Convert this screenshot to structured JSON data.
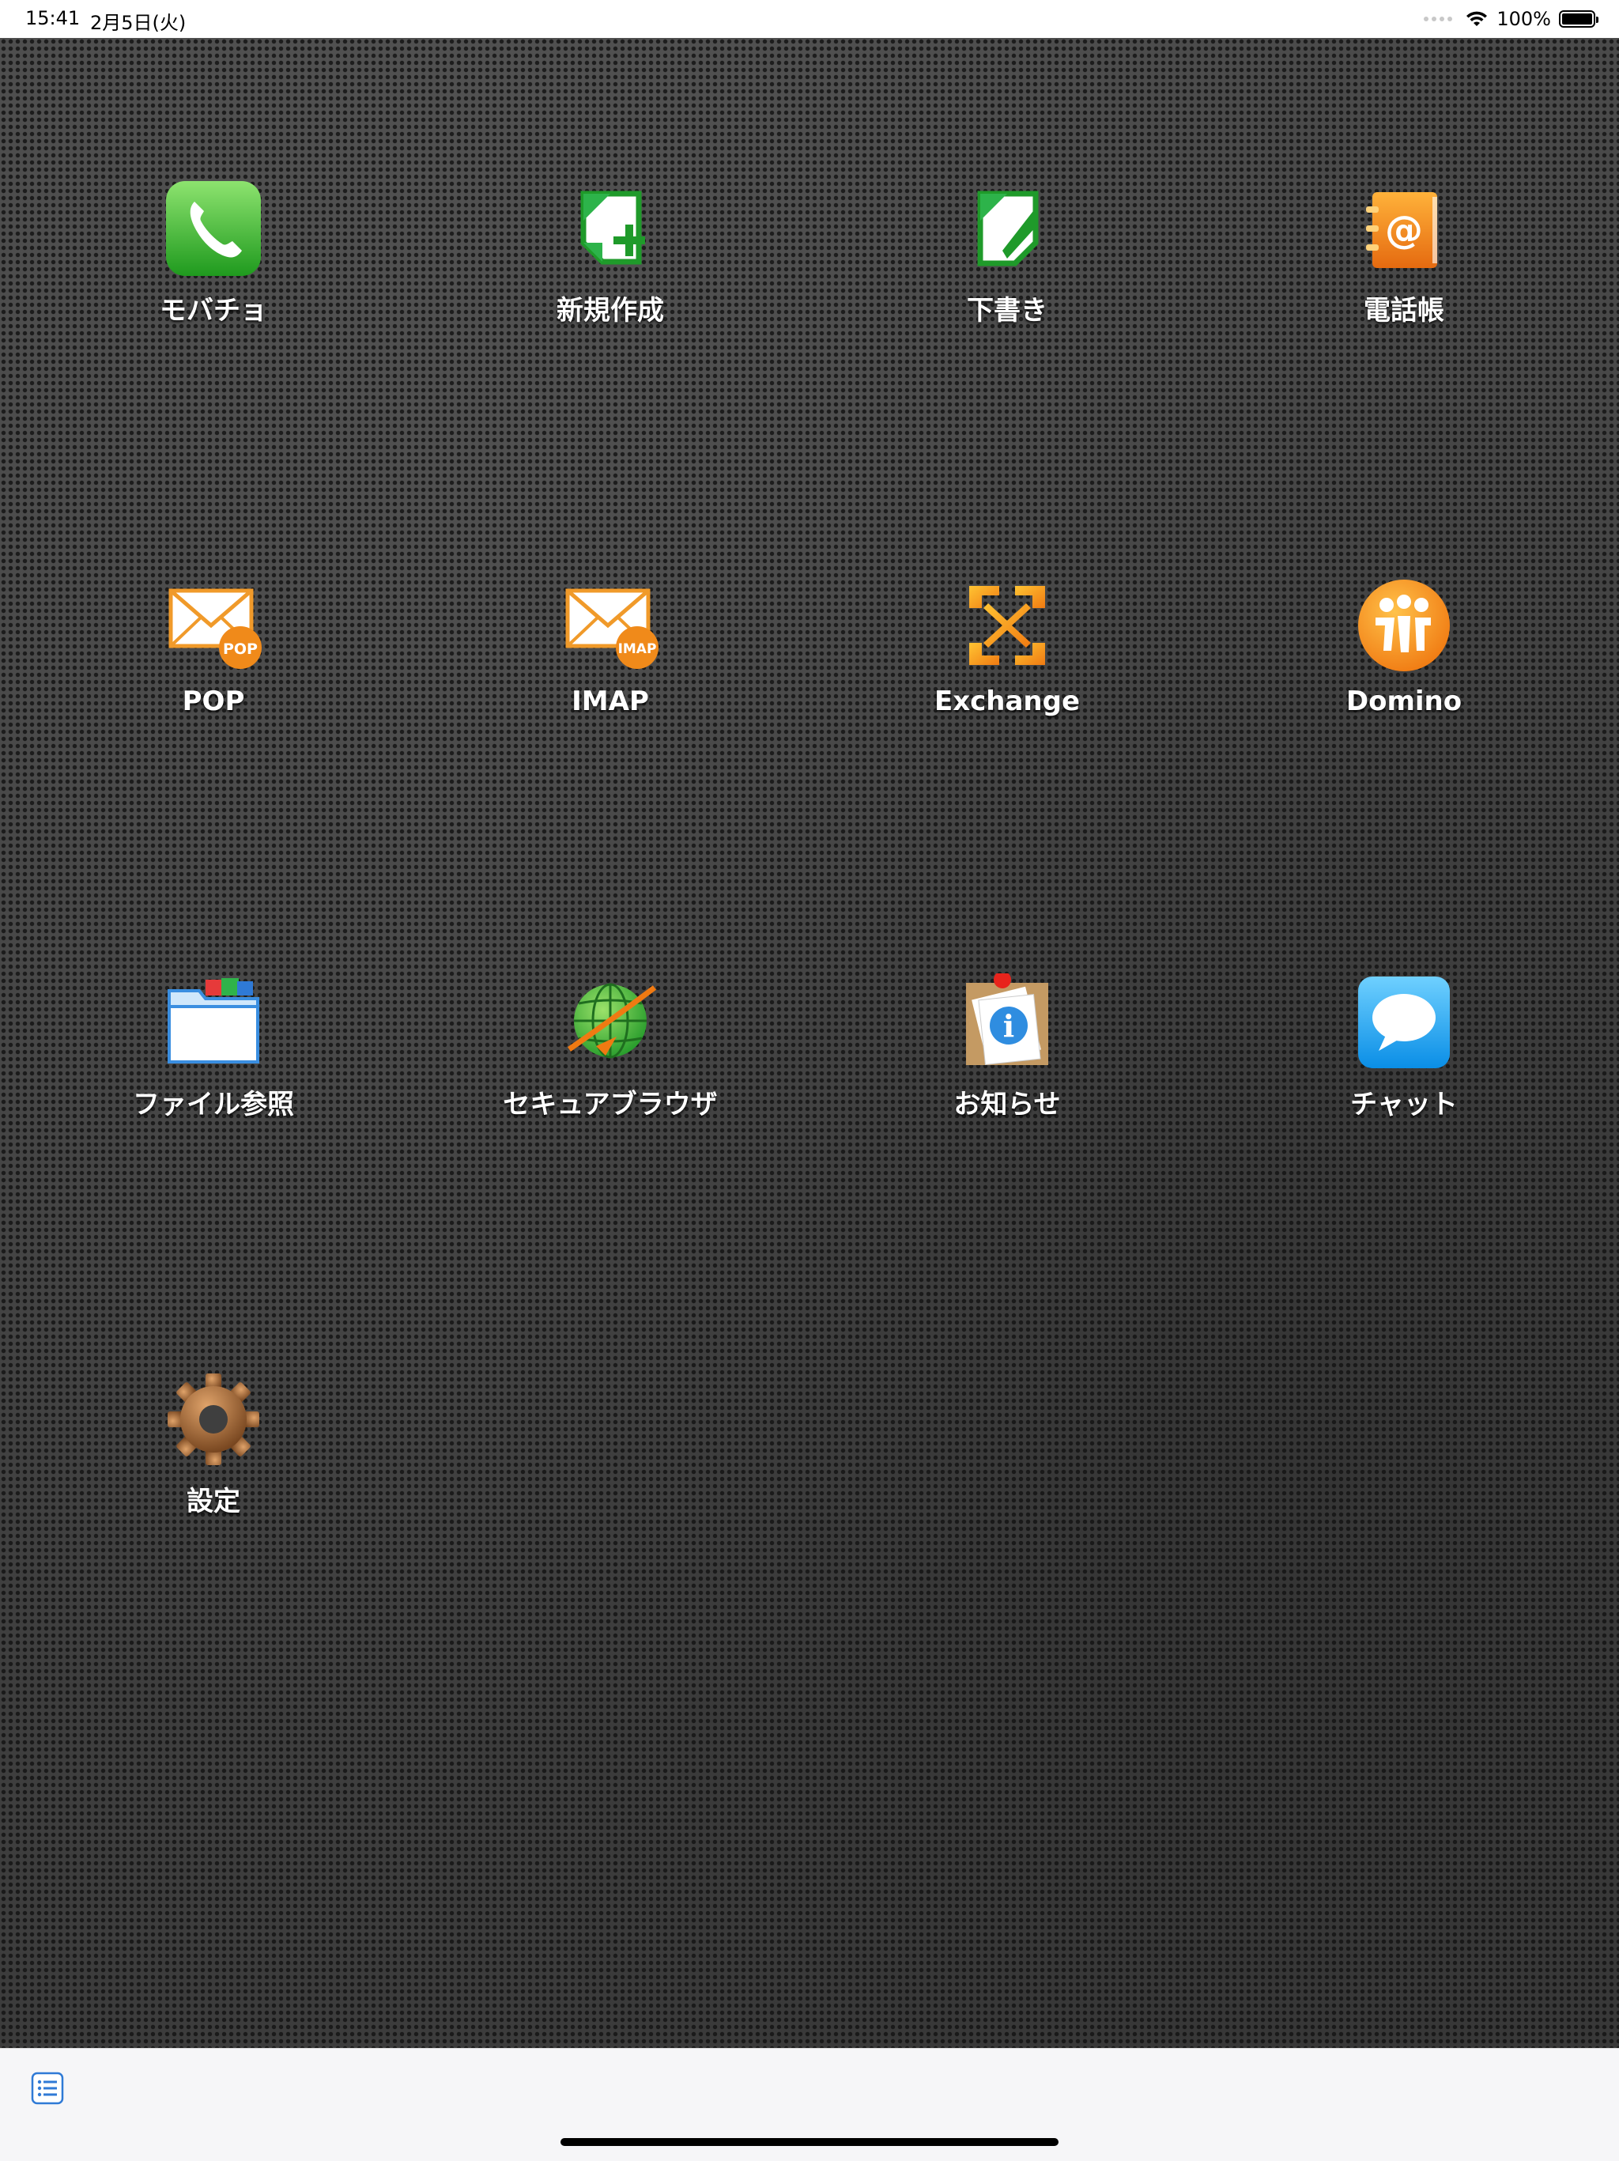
{
  "status_bar": {
    "time": "15:41",
    "date": "2月5日(火)",
    "battery": "100%",
    "battery_level": 1.0
  },
  "apps": [
    {
      "label": "モバチョ",
      "icon": "phone-icon"
    },
    {
      "label": "新規作成",
      "icon": "new-document-icon"
    },
    {
      "label": "下書き",
      "icon": "draft-icon"
    },
    {
      "label": "電話帳",
      "icon": "address-book-icon"
    },
    {
      "label": "POP",
      "icon": "pop-mail-icon",
      "badge": "POP"
    },
    {
      "label": "IMAP",
      "icon": "imap-mail-icon",
      "badge": "IMAP"
    },
    {
      "label": "Exchange",
      "icon": "exchange-icon"
    },
    {
      "label": "Domino",
      "icon": "domino-icon"
    },
    {
      "label": "ファイル参照",
      "icon": "folder-icon"
    },
    {
      "label": "セキュアブラウザ",
      "icon": "globe-icon"
    },
    {
      "label": "お知らせ",
      "icon": "notice-icon"
    },
    {
      "label": "チャット",
      "icon": "chat-icon"
    },
    {
      "label": "設定",
      "icon": "gear-icon"
    }
  ],
  "toolbar": {
    "list_icon": "list-icon"
  },
  "colors": {
    "background": "#444444",
    "toolbar": "#f6f6f8",
    "label": "#ffffff",
    "accent_blue": "#2f7ad6"
  }
}
